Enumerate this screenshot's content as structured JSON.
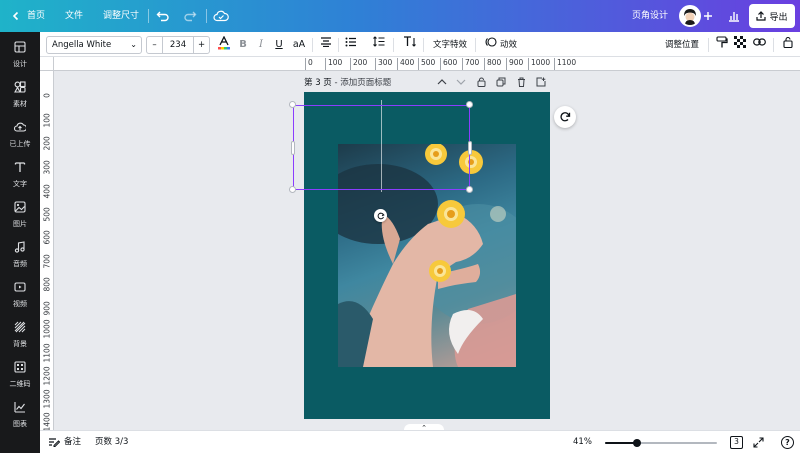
{
  "topbar": {
    "home": "首页",
    "file": "文件",
    "resize": "调整尺寸",
    "design_title": "页角设计",
    "export": "导出"
  },
  "sidebar": {
    "items": [
      {
        "label": "设计",
        "icon": "layout-icon"
      },
      {
        "label": "素材",
        "icon": "elements-icon"
      },
      {
        "label": "已上传",
        "icon": "upload-icon"
      },
      {
        "label": "文字",
        "icon": "text-icon"
      },
      {
        "label": "图片",
        "icon": "photo-icon"
      },
      {
        "label": "音频",
        "icon": "music-icon"
      },
      {
        "label": "视频",
        "icon": "video-icon"
      },
      {
        "label": "背景",
        "icon": "background-icon"
      },
      {
        "label": "二维码",
        "icon": "qrcode-icon"
      },
      {
        "label": "图表",
        "icon": "chart-icon"
      }
    ]
  },
  "toolbar": {
    "font": "Angella White",
    "font_size": "234",
    "minus": "–",
    "plus": "+",
    "bold": "B",
    "italic": "I",
    "underline": "U",
    "case": "aA",
    "text_effects": "文字特效",
    "animate": "动效",
    "position": "调整位置"
  },
  "ruler": {
    "top": [
      "0",
      "100",
      "200",
      "300",
      "400",
      "500",
      "600",
      "700",
      "800",
      "900",
      "1000",
      "1100"
    ],
    "left": [
      "0",
      "100",
      "200",
      "300",
      "400",
      "500",
      "600",
      "700",
      "800",
      "900",
      "1000",
      "1100",
      "1200",
      "1300",
      "1400"
    ]
  },
  "page": {
    "title": "第 3 页",
    "subtitle": "- 添加页面标题",
    "background": "#0a5b63"
  },
  "bottombar": {
    "notes": "备注",
    "pages": "页数 3/3",
    "zoom": "41%",
    "zoom_fraction": 0.41,
    "page_badge": "3",
    "help": "?"
  },
  "colors": {
    "accent": "#8b3dff",
    "page_bg": "#0a5b63",
    "sidebar_bg": "#18191b"
  }
}
